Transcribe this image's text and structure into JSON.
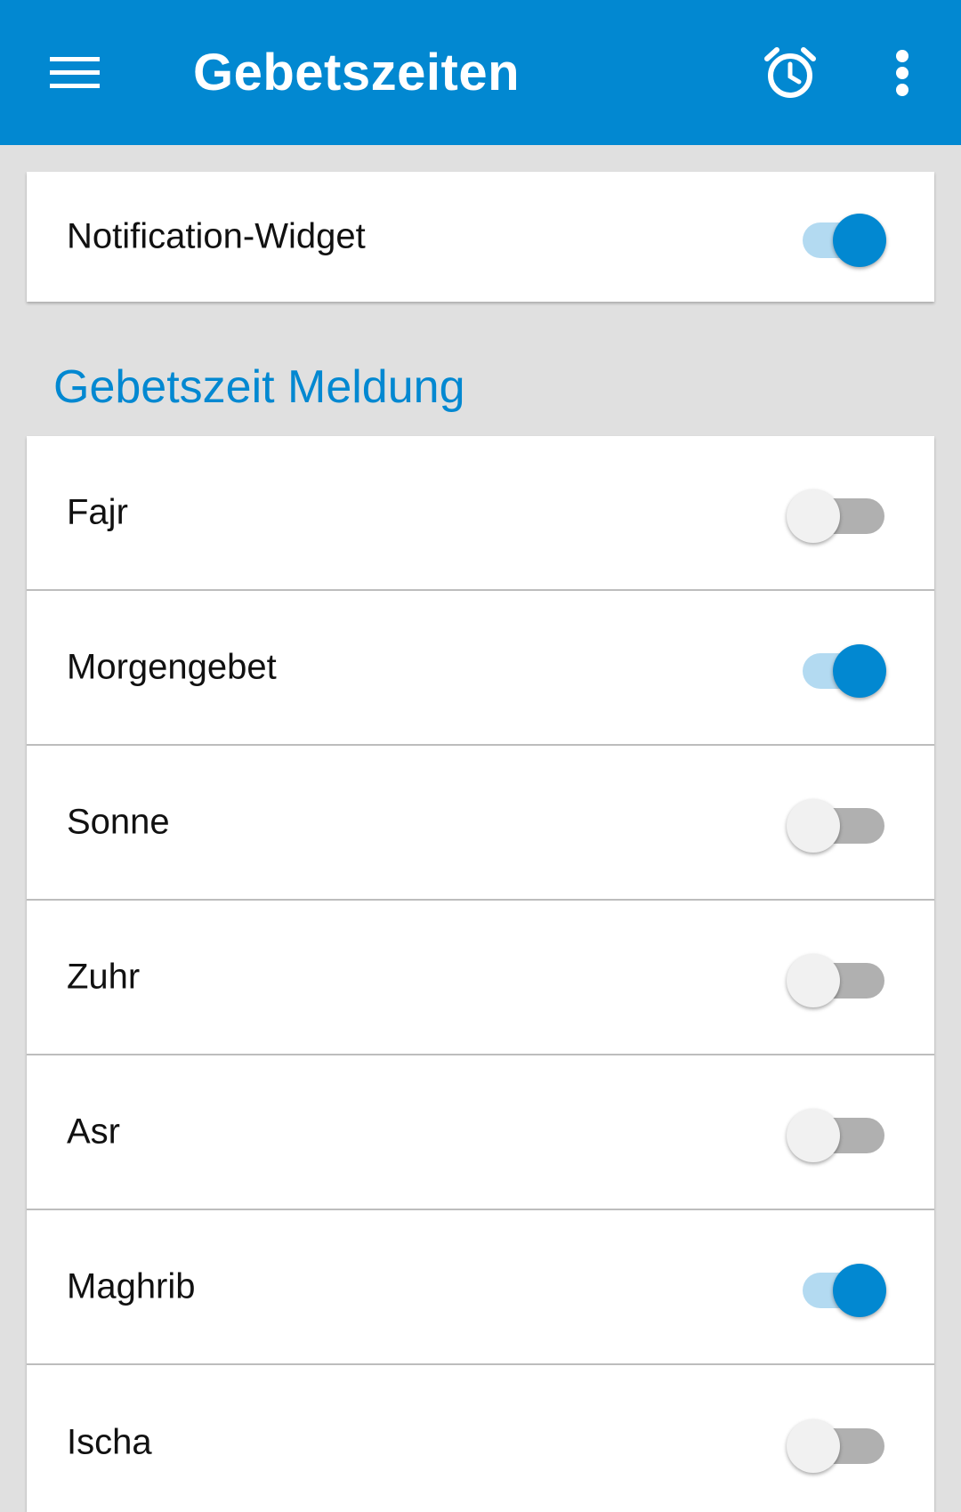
{
  "appbar": {
    "title": "Gebetszeiten",
    "icons": [
      "menu-icon",
      "alarm-clock-icon",
      "more-vert-icon"
    ],
    "color": "#0288d1"
  },
  "widget": {
    "label": "Notification-Widget",
    "enabled": true
  },
  "section": {
    "title": "Gebetszeit Meldung"
  },
  "prayers": [
    {
      "label": "Fajr",
      "enabled": false
    },
    {
      "label": "Morgengebet",
      "enabled": true
    },
    {
      "label": "Sonne",
      "enabled": false
    },
    {
      "label": "Zuhr",
      "enabled": false
    },
    {
      "label": "Asr",
      "enabled": false
    },
    {
      "label": "Maghrib",
      "enabled": true
    },
    {
      "label": "Ischa",
      "enabled": false
    }
  ],
  "colors": {
    "accent": "#0288d1",
    "switch_track_on": "#b3daf1",
    "switch_track_off": "#b0b0b0",
    "switch_thumb_off": "#f1f1f1",
    "background": "#e0e0e0"
  }
}
